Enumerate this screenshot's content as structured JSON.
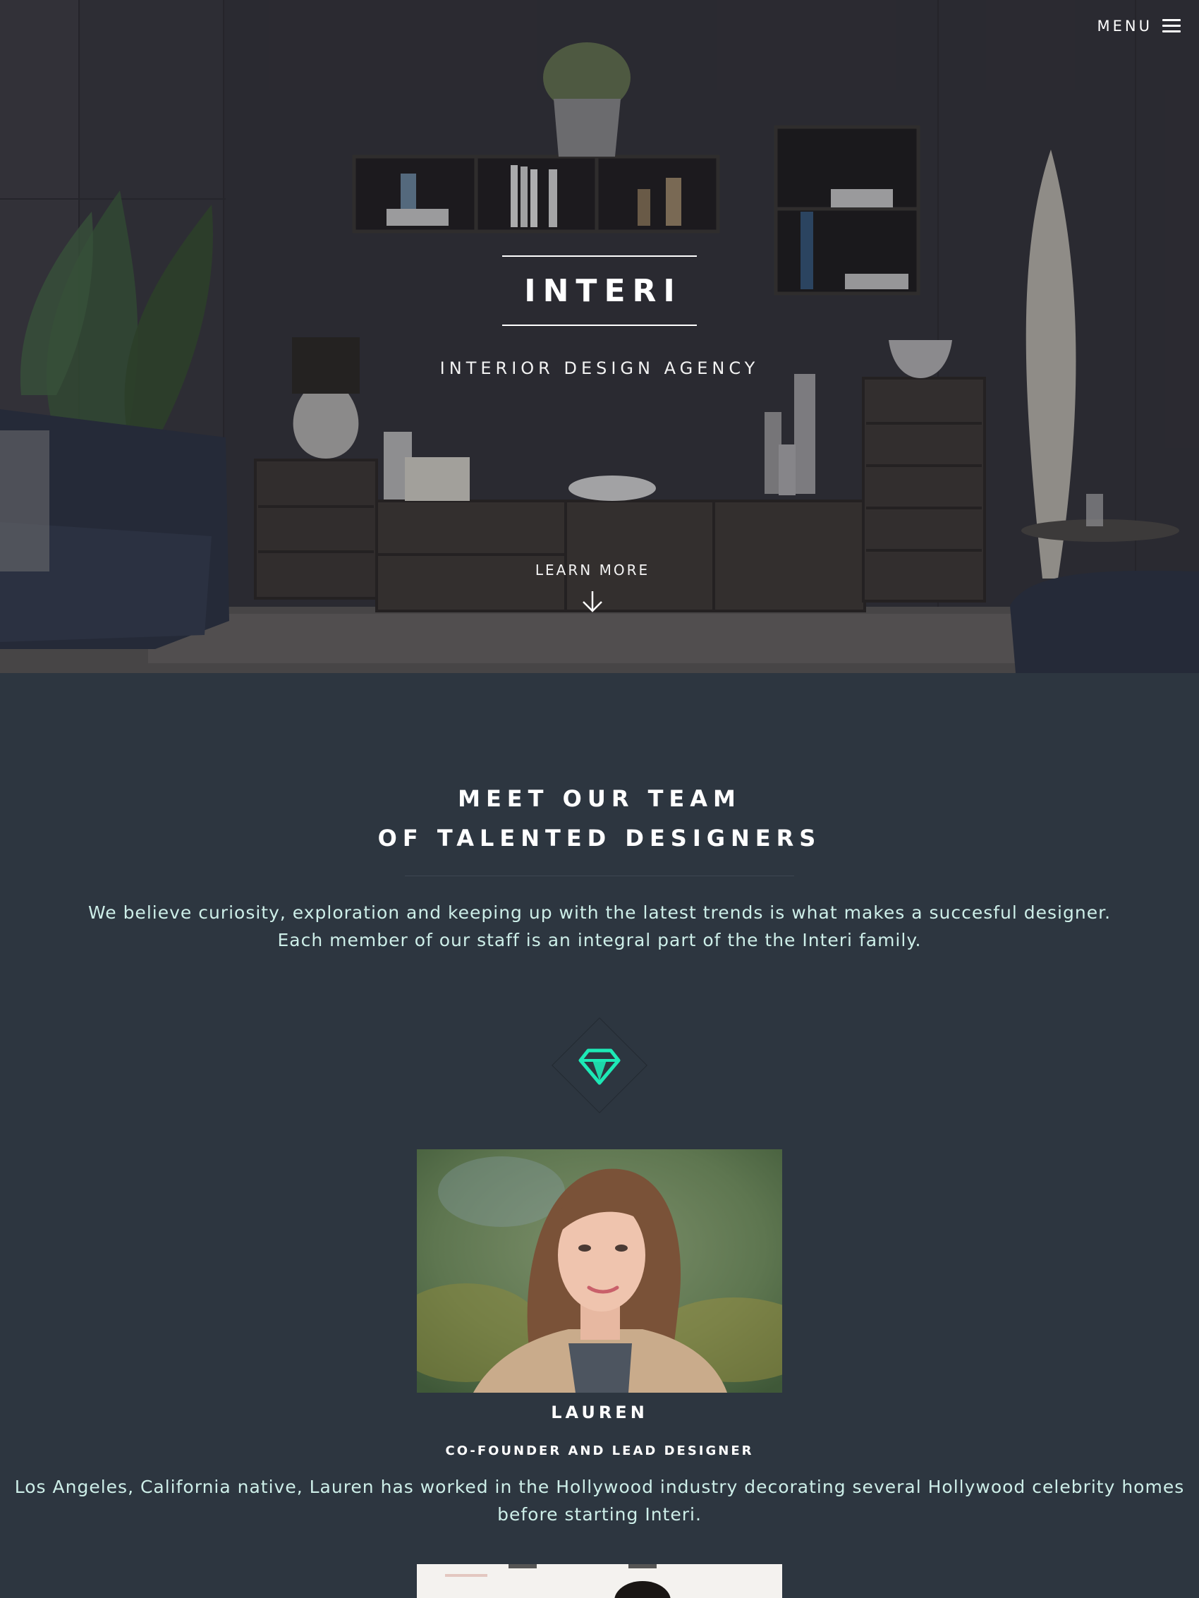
{
  "header": {
    "menu_label": "MENU",
    "menu_icon": "hamburger-icon"
  },
  "hero": {
    "title": "INTERI",
    "subtitle": "INTERIOR DESIGN AGENCY",
    "cta_label": "LEARN MORE",
    "cta_icon": "arrow-down-icon",
    "background_image": "living-room-interior"
  },
  "team": {
    "heading_line1": "MEET OUR TEAM",
    "heading_line2": "OF TALENTED DESIGNERS",
    "intro": "We believe curiosity, exploration and keeping up with the latest trends is what makes a succesful designer. Each member of our staff is an integral part of the the Interi family.",
    "divider_icon": "gem-icon",
    "members": [
      {
        "name": "LAUREN",
        "role": "CO-FOUNDER AND LEAD DESIGNER",
        "bio": "Los Angeles, California native, Lauren has worked in the Hollywood industry decorating several Hollywood celebrity homes before starting Interi.",
        "photo": "portrait-lauren"
      }
    ]
  },
  "colors": {
    "section_bg": "#2d3640",
    "accent": "#1de9b6",
    "body_text": "#cdeee8",
    "heading_text": "#ffffff"
  }
}
